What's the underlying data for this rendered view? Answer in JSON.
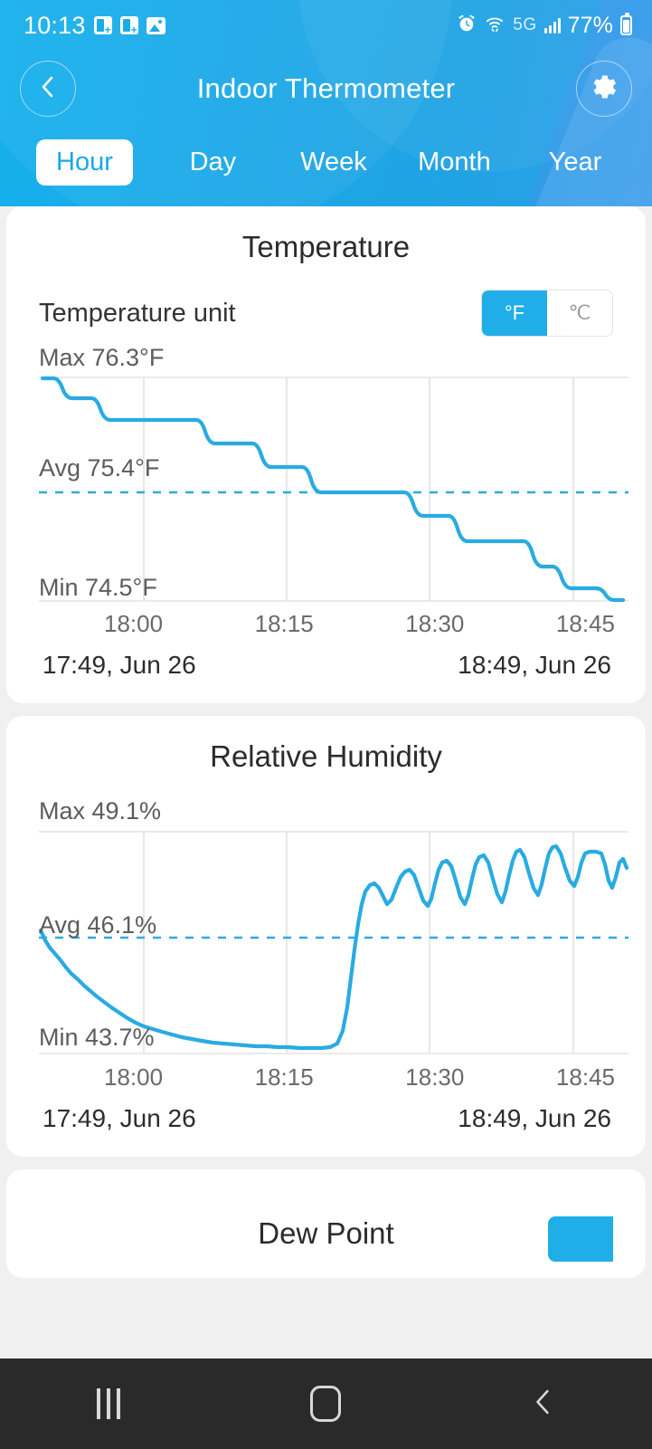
{
  "statusbar": {
    "time": "10:13",
    "icons_left": [
      "office-badge-icon",
      "office-badge-icon",
      "photo-icon"
    ],
    "alarm_icon": "alarm-icon",
    "wifi_icon": "wifi-icon",
    "network": "5G",
    "signal_icon": "signal-bars-icon",
    "battery": "77%",
    "battery_icon": "battery-icon"
  },
  "header": {
    "back_icon": "chevron-left-icon",
    "title": "Indoor Thermometer",
    "settings_icon": "gear-icon"
  },
  "tabs": [
    {
      "label": "Hour",
      "active": true
    },
    {
      "label": "Day",
      "active": false
    },
    {
      "label": "Week",
      "active": false
    },
    {
      "label": "Month",
      "active": false
    },
    {
      "label": "Year",
      "active": false
    }
  ],
  "temperature_card": {
    "title": "Temperature",
    "unit_label": "Temperature unit",
    "unit_options": [
      "°F",
      "℃"
    ],
    "unit_selected": "°F",
    "max_label": "Max 76.3°F",
    "avg_label": "Avg 75.4°F",
    "min_label": "Min 74.5°F",
    "xticks": [
      "18:00",
      "18:15",
      "18:30",
      "18:45"
    ],
    "range_start": "17:49,  Jun 26",
    "range_end": "18:49,  Jun 26"
  },
  "humidity_card": {
    "title": "Relative Humidity",
    "max_label": "Max 49.1%",
    "avg_label": "Avg 46.1%",
    "min_label": "Min 43.7%",
    "xticks": [
      "18:00",
      "18:15",
      "18:30",
      "18:45"
    ],
    "range_start": "17:49,  Jun 26",
    "range_end": "18:49,  Jun 26"
  },
  "partial_card": {
    "title": "Dew Point"
  },
  "sysnav": {
    "recents_icon": "recents-icon",
    "home_icon": "home-icon",
    "back_icon": "back-chevron-icon"
  },
  "colors": {
    "accent": "#29ABE2",
    "header_blue": "#19ACE5",
    "line": "#29ABE2",
    "grid": "#e3e3e3",
    "text_dark": "#2b2b2b",
    "text_muted": "#5c5c5c"
  },
  "chart_data": [
    {
      "type": "line",
      "title": "Temperature",
      "xlabel": "",
      "ylabel": "°F",
      "ylim": [
        74.5,
        76.3
      ],
      "xlim": [
        "17:49",
        "18:49"
      ],
      "xticks": [
        "18:00",
        "18:15",
        "18:30",
        "18:45"
      ],
      "max": 76.3,
      "avg": 75.4,
      "min": 74.5,
      "unit": "°F",
      "grid": true,
      "avg_reference_line": 75.4,
      "series": [
        {
          "name": "Temperature",
          "x": [
            "17:49",
            "17:51",
            "17:52",
            "17:57",
            "17:58",
            "18:04",
            "18:05",
            "18:12",
            "18:13",
            "18:26",
            "18:27",
            "18:32",
            "18:33",
            "18:36",
            "18:37",
            "18:43",
            "18:44",
            "18:45",
            "18:46",
            "18:47",
            "18:48",
            "18:49"
          ],
          "values": [
            76.3,
            76.3,
            76.1,
            76.1,
            75.9,
            75.9,
            75.7,
            75.7,
            75.6,
            75.6,
            75.4,
            75.4,
            75.2,
            75.2,
            75.1,
            75.1,
            74.9,
            74.9,
            74.8,
            74.8,
            74.6,
            74.5
          ]
        }
      ]
    },
    {
      "type": "line",
      "title": "Relative Humidity",
      "xlabel": "",
      "ylabel": "%",
      "ylim": [
        43.7,
        49.1
      ],
      "xlim": [
        "17:49",
        "18:49"
      ],
      "xticks": [
        "18:00",
        "18:15",
        "18:30",
        "18:45"
      ],
      "max": 49.1,
      "avg": 46.1,
      "min": 43.7,
      "unit": "%",
      "grid": true,
      "avg_reference_line": 46.1,
      "series": [
        {
          "name": "Relative Humidity",
          "x": [
            "17:49",
            "17:50",
            "17:51",
            "17:52",
            "17:53",
            "17:54",
            "17:55",
            "17:56",
            "17:57",
            "17:58",
            "17:59",
            "18:00",
            "18:01",
            "18:02",
            "18:03",
            "18:04",
            "18:05",
            "18:06",
            "18:07",
            "18:08",
            "18:09",
            "18:10",
            "18:11",
            "18:12",
            "18:13",
            "18:14",
            "18:15",
            "18:16",
            "18:17",
            "18:18",
            "18:19",
            "18:20",
            "18:21",
            "18:22",
            "18:23",
            "18:24",
            "18:25",
            "18:26",
            "18:27",
            "18:28",
            "18:29",
            "18:30",
            "18:31",
            "18:32",
            "18:33",
            "18:34",
            "18:35",
            "18:36",
            "18:37",
            "18:38",
            "18:39",
            "18:40",
            "18:41",
            "18:42",
            "18:43",
            "18:44",
            "18:45",
            "18:46",
            "18:47",
            "18:48",
            "18:49"
          ],
          "values": [
            46.3,
            45.9,
            45.6,
            45.4,
            45.2,
            45.0,
            44.8,
            44.7,
            44.5,
            44.4,
            44.3,
            44.2,
            44.1,
            44.0,
            43.95,
            43.9,
            43.9,
            43.85,
            43.8,
            43.8,
            43.78,
            43.75,
            43.75,
            43.72,
            43.7,
            43.7,
            43.7,
            43.7,
            43.7,
            43.75,
            44.3,
            45.5,
            46.6,
            47.5,
            47.2,
            47.9,
            47.5,
            48.3,
            47.9,
            47.3,
            48.3,
            48.0,
            47.4,
            48.3,
            47.9,
            47.3,
            48.5,
            48.6,
            47.9,
            48.5,
            48.1,
            47.6,
            48.9,
            48.2,
            48.6,
            48.9,
            48.4,
            48.7,
            48.7,
            48.3,
            48.6
          ]
        }
      ]
    }
  ]
}
